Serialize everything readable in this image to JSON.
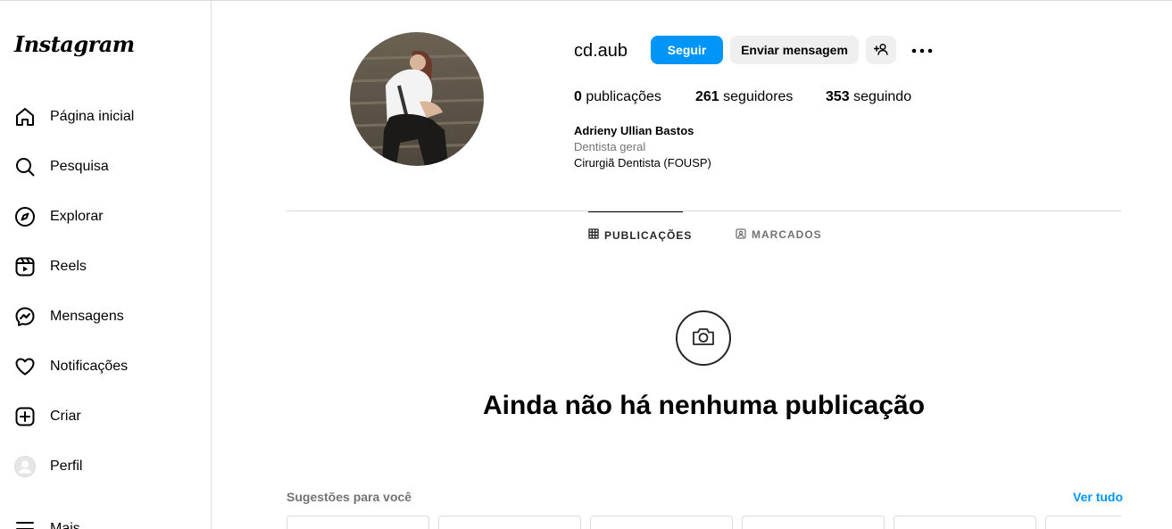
{
  "app": {
    "logo": "Instagram"
  },
  "sidebar": {
    "items": [
      {
        "label": "Página inicial",
        "icon": "home-icon"
      },
      {
        "label": "Pesquisa",
        "icon": "search-icon"
      },
      {
        "label": "Explorar",
        "icon": "compass-icon"
      },
      {
        "label": "Reels",
        "icon": "reels-icon"
      },
      {
        "label": "Mensagens",
        "icon": "messenger-icon"
      },
      {
        "label": "Notificações",
        "icon": "heart-icon"
      },
      {
        "label": "Criar",
        "icon": "plus-square-icon"
      },
      {
        "label": "Perfil",
        "icon": "avatar-icon"
      },
      {
        "label": "Mais",
        "icon": "menu-icon"
      }
    ]
  },
  "profile": {
    "username": "cd.aub",
    "follow_label": "Seguir",
    "message_label": "Enviar mensagem",
    "posts_count": "0",
    "posts_label": "publicações",
    "followers_count": "261",
    "followers_label": "seguidores",
    "following_count": "353",
    "following_label": "seguindo",
    "full_name": "Adrieny Ullian Bastos",
    "category": "Dentista geral",
    "bio": "Cirurgiã Dentista (FOUSP)"
  },
  "tabs": [
    {
      "label": "PUBLICAÇÕES",
      "icon": "grid-icon",
      "active": true
    },
    {
      "label": "MARCADOS",
      "icon": "tagged-icon",
      "active": false
    }
  ],
  "empty_state": {
    "title": "Ainda não há nenhuma publicação",
    "icon": "camera-icon"
  },
  "suggestions": {
    "title": "Sugestões para você",
    "see_all": "Ver tudo"
  },
  "colors": {
    "accent": "#0095f6",
    "secondary_button": "#efefef",
    "muted_text": "#737373",
    "border": "#dbdbdb"
  }
}
